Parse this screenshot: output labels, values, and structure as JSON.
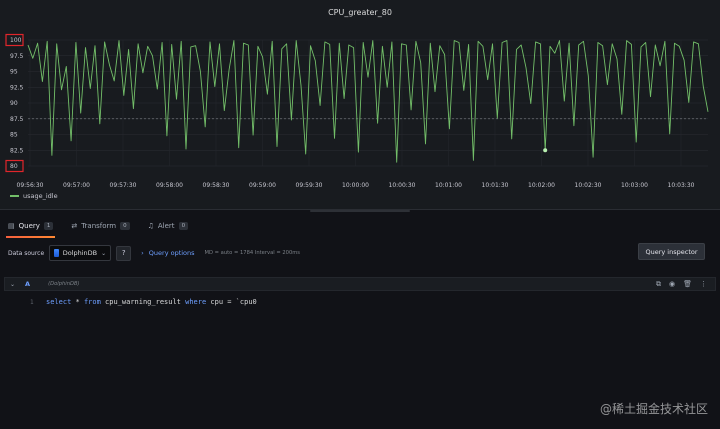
{
  "panel": {
    "title": "CPU_greater_80",
    "legend": "usage_idle",
    "line_color": "#73bf69",
    "highlight_color": "#e0262b"
  },
  "chart_data": {
    "type": "line",
    "title": "CPU_greater_80",
    "y_ticks": [
      "100",
      "97.5",
      "95",
      "92.5",
      "90",
      "87.5",
      "85",
      "82.5",
      "80"
    ],
    "ylim": [
      80,
      100
    ],
    "x_ticks": [
      "09:56:30",
      "09:57:00",
      "09:57:30",
      "09:58:00",
      "09:58:30",
      "09:59:00",
      "09:59:30",
      "10:00:00",
      "10:00:30",
      "10:01:00",
      "10:01:30",
      "10:02:00",
      "10:02:30",
      "10:03:00",
      "10:03:30"
    ],
    "threshold": 87.5,
    "series": [
      {
        "name": "usage_idle",
        "values": [
          99.2,
          97.1,
          99.5,
          93.4,
          99.8,
          81.7,
          99.4,
          92.1,
          95.8,
          84.0,
          99.6,
          88.4,
          98.8,
          92.3,
          99.1,
          86.7,
          99.7,
          96.1,
          93.5,
          99.9,
          91.2,
          98.5,
          89.1,
          99.4,
          94.8,
          99.0,
          97.5,
          92.2,
          99.6,
          84.8,
          99.3,
          90.6,
          99.8,
          82.7,
          98.9,
          99.1,
          95.0,
          86.2,
          99.7,
          92.6,
          99.4,
          88.8,
          95.3,
          99.9,
          82.9,
          99.5,
          99.2,
          84.9,
          99.0,
          97.3,
          91.4,
          99.8,
          83.1,
          98.6,
          99.4,
          87.3,
          99.9,
          92.8,
          81.9,
          99.1,
          96.7,
          89.6,
          99.7,
          99.3,
          84.4,
          99.5,
          90.7,
          99.2,
          98.8,
          82.2,
          99.6,
          94.1,
          99.9,
          86.8,
          99.0,
          92.5,
          99.7,
          80.6,
          99.4,
          99.2,
          88.9,
          99.8,
          96.4,
          83.5,
          99.5,
          91.8,
          99.1,
          97.7,
          85.9,
          99.9,
          99.6,
          92.0,
          99.3,
          80.9,
          99.8,
          99.0,
          93.7,
          99.4,
          87.6,
          99.6,
          99.9,
          84.3,
          98.5,
          99.2,
          95.6,
          89.9,
          99.7,
          99.4,
          82.5,
          99.0,
          97.9,
          99.9,
          90.3,
          99.5,
          86.4,
          99.2,
          99.8,
          94.3,
          81.4,
          99.6,
          99.1,
          92.9,
          99.4,
          97.0,
          88.2,
          99.9,
          99.3,
          83.8,
          98.9,
          99.6,
          91.0,
          99.2,
          95.9,
          99.8,
          85.1,
          99.5,
          99.0,
          96.8,
          90.1,
          99.7,
          99.4,
          92.7,
          88.6
        ]
      }
    ]
  },
  "tabs": [
    {
      "label": "Query",
      "count": "1"
    },
    {
      "label": "Transform",
      "count": "0"
    },
    {
      "label": "Alert",
      "count": "0"
    }
  ],
  "query_bar": {
    "datasource_label": "Data source",
    "datasource": "DolphinDB",
    "query_options_label": "Query options",
    "meta": "MD = auto = 1784    Interval = 200ms",
    "inspector_label": "Query inspector"
  },
  "query": {
    "ref_id": "A",
    "datasource_name": "(DolphinDB)",
    "line_number": "1",
    "code_select": "select",
    "code_star": " * ",
    "code_from": "from",
    "code_table": " cpu_warning_result ",
    "code_where": "where",
    "code_cond": " cpu = `cpu0"
  },
  "watermark": "@稀土掘金技术社区"
}
